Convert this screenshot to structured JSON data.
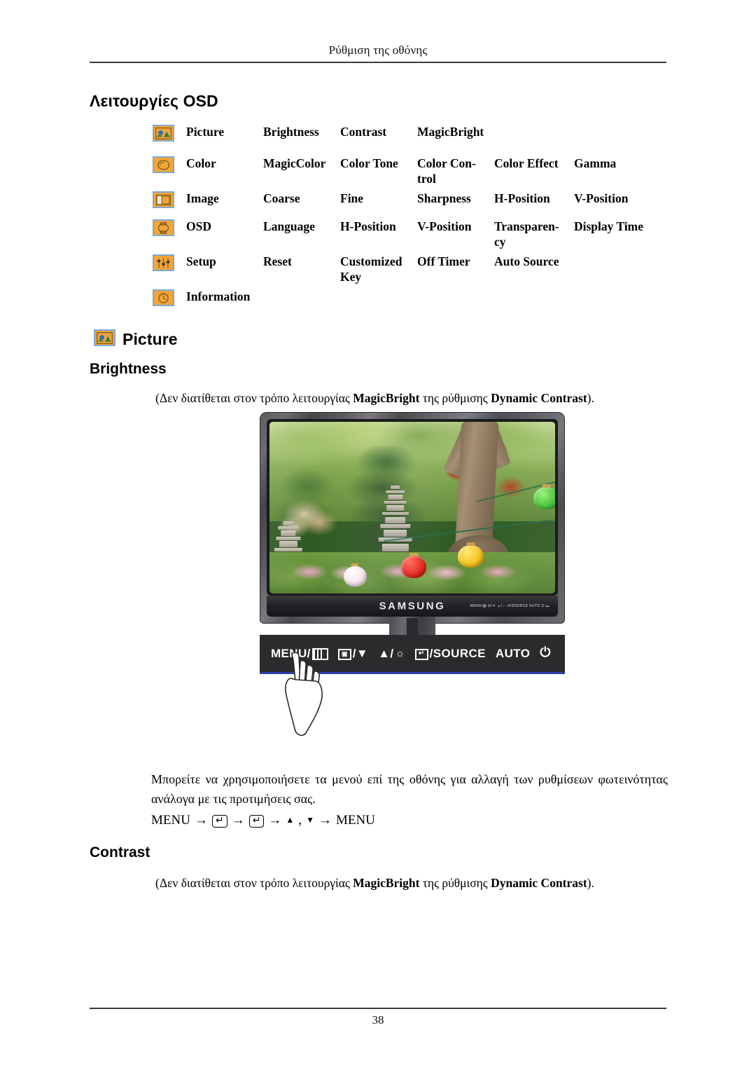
{
  "header": {
    "running_title": "Ρύθμιση της οθόνης"
  },
  "footer": {
    "page_number": "38"
  },
  "section": {
    "title": "Λειτουργίες OSD"
  },
  "osd_table": {
    "rows": [
      {
        "icon": "picture-icon",
        "label": "Picture",
        "items": [
          "Brightness",
          "Contrast",
          "MagicBright",
          "",
          ""
        ]
      },
      {
        "icon": "color-icon",
        "label": "Color",
        "items": [
          "MagicColor",
          "Color Tone",
          "Color  Con-\ntrol",
          "Color Effect",
          "Gamma"
        ]
      },
      {
        "icon": "image-icon",
        "label": "Image",
        "items": [
          "Coarse",
          "Fine",
          "Sharpness",
          "H-Position",
          "V-Position"
        ]
      },
      {
        "icon": "osd-icon",
        "label": "OSD",
        "items": [
          "Language",
          "H-Position",
          "V-Position",
          "Transparen-\ncy",
          "Display Time"
        ]
      },
      {
        "icon": "setup-icon",
        "label": "Setup",
        "items": [
          "Reset",
          "Customized\nKey",
          "Off Timer",
          "Auto Source",
          ""
        ]
      },
      {
        "icon": "information-icon",
        "label": "Information",
        "items": [
          "",
          "",
          "",
          "",
          ""
        ]
      }
    ]
  },
  "picture_section": {
    "heading": "Picture",
    "icon": "picture-icon"
  },
  "brightness_section": {
    "heading": "Brightness",
    "note_prefix": "(Δεν διατίθεται στον τρόπο λειτουργίας ",
    "note_bold_1": "MagicBright",
    "note_middle": " της ρύθμισης ",
    "note_bold_2": "Dynamic Contrast",
    "note_suffix": ").",
    "body": "Μπορείτε να χρησιμοποιήσετε τα μενού επί της οθόνης για αλλαγή των ρυθμίσεων φωτεινότητας ανάλογα με τις προτιμήσεις σας.",
    "menu_sequence": {
      "start": "MENU",
      "arrow": "→",
      "key_enter": "↵",
      "up_arrow": "▲",
      "comma": ",",
      "down_arrow": "▼",
      "end": "MENU"
    }
  },
  "contrast_section": {
    "heading": "Contrast",
    "note_prefix": "(Δεν διατίθεται στον τρόπο λειτουργίας ",
    "note_bold_1": "MagicBright",
    "note_middle": " της ρύθμισης ",
    "note_bold_2": "Dynamic Contrast",
    "note_suffix": ")."
  },
  "monitor_figure": {
    "brand": "SAMSUNG",
    "bezel_keys": "MENU/▥  ⊡/▼  ▲/☼  ⏎/SOURCE  AUTO  ⏻  ▬",
    "control_bar": {
      "menu_label": "MENU/",
      "down_label": "/▼",
      "up_label": "▲/",
      "source_label": "/SOURCE",
      "auto_label": "AUTO",
      "power_glyph": "⏻",
      "led": "power-led"
    }
  },
  "colors": {
    "icon_fill": "#F2A63A",
    "icon_border": "#7FA8D4",
    "led_blue": "#2B4FD8",
    "bar_accent": "#2B3EA8"
  }
}
